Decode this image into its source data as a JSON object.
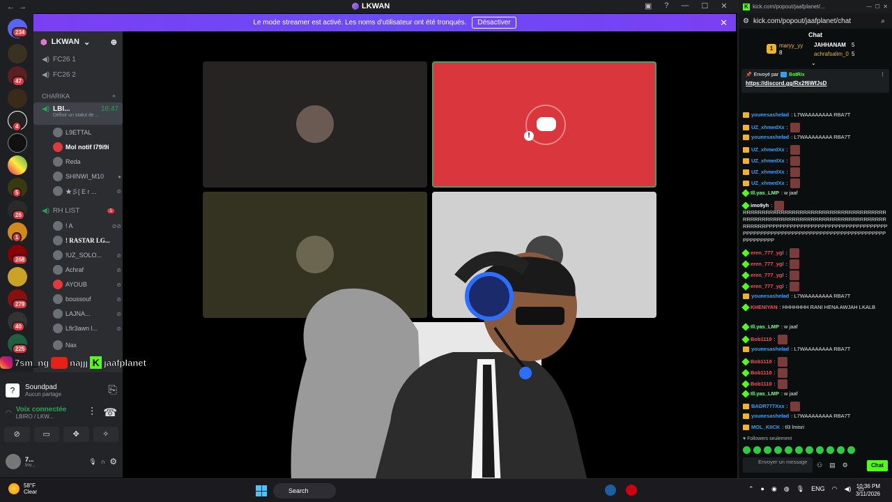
{
  "discord": {
    "window_title": "LKWAN",
    "banner_text": "Le mode streamer est activé. Les noms d'utilisateur ont été tronqués.",
    "banner_button": "Désactiver",
    "server_name": "LKWAN",
    "guild_badges": [
      "234",
      "47",
      "4",
      "5",
      "26",
      "1",
      "268",
      "279",
      "40",
      "225"
    ],
    "channels": [
      {
        "label": "FC26 1"
      },
      {
        "label": "FC26 2"
      }
    ],
    "category": "CHARIKA",
    "active_channel": {
      "label": "LBI...",
      "time": "16:47",
      "status": "Définir un statut de ..."
    },
    "active_users": [
      "L9ETTAL",
      "Mol notif l79i9i",
      "Reda",
      "SHINWI_M10",
      "★彡[ E r ..."
    ],
    "rh_channel": {
      "label": "RH LIST",
      "badge": "1"
    },
    "rh_users": [
      "! A",
      "! RASTAR LG...",
      "!UZ_SOLO...",
      "Achraf",
      "AYOUB",
      "boussouf",
      "LAJNA...",
      "Lfir3awn l...",
      "Nax"
    ],
    "soundpad": {
      "title": "Soundpad",
      "subtitle": "Aucun partage"
    },
    "voice": {
      "title": "Voix connectée",
      "subtitle": "LBIRO / LKW..."
    },
    "me": {
      "name": "7...",
      "status": "Inv..."
    }
  },
  "socials": [
    "7sm_ng",
    "najjj",
    "jaafplanet"
  ],
  "kick": {
    "title_url": "kick.com/popout/jaafplanet/...",
    "url": "kick.com/popout/jaafplanet/chat",
    "header": "Chat",
    "leaderboard": [
      {
        "rank": "1",
        "name": "maryy_yy",
        "count": "8"
      },
      {
        "name": "JAHHANAM",
        "count": "5"
      },
      {
        "name": "achrafsalim_0",
        "count": "5"
      }
    ],
    "pinned_by": "Envoyé par",
    "pinned_user": "BotRix",
    "pinned_link": "https://discord.gg/Rx2f6WfJsD",
    "messages": [
      {
        "user": "younesashelad",
        "text": ": L7WAAAAAAAA RBA7T",
        "color": "#2ea0ff"
      },
      {
        "user": "UZ_xhmedXx",
        "text": ":",
        "color": "#2ea0ff"
      },
      {
        "user": "younesashelad",
        "text": ": L7WAAAAAAAA RBA7T",
        "color": "#2ea0ff"
      },
      {
        "user": "UZ_xhmedXx",
        "text": ":",
        "color": "#2ea0ff"
      },
      {
        "user": "UZ_xhmedXx",
        "text": ":",
        "color": "#2ea0ff"
      },
      {
        "user": "UZ_xhmedXx",
        "text": ":",
        "color": "#2ea0ff"
      },
      {
        "user": "UZ_xhmedXx",
        "text": ":",
        "color": "#2ea0ff"
      },
      {
        "user": "Ill.yas_LMP",
        "text": ": w jaaf",
        "color": "#7cfc8a"
      },
      {
        "user": "imo9yh",
        "text": ":",
        "color": "#ffffff"
      },
      {
        "user": "",
        "text": "RRRRRRRRRRRRRRRRRRRRRRRRRRRRRRRRRRRRRRRRRRRRRRRRRRRRRRRRRRRRRRRRRRRRRRRRRRRRRRRRRRPPPPPPPPPPPPPPPPPPPPPPPPPPPPPPPPPPPPPPPPPPPPPPPPPPPPPPPPPPPPPPPPPPPPPPPPPPPPPPPPPPPPP",
        "color": "#ffffff"
      },
      {
        "user": "eren_777_ygl",
        "text": ":",
        "color": "#ff4d4d"
      },
      {
        "user": "eren_777_ygl",
        "text": ":",
        "color": "#ff4d4d"
      },
      {
        "user": "eren_777_ygl",
        "text": ":",
        "color": "#ff4d4d"
      },
      {
        "user": "eren_777_ygl",
        "text": ":",
        "color": "#ff4d4d"
      },
      {
        "user": "younesashelad",
        "text": ": L7WAAAAAAAA RBA7T",
        "color": "#2ea0ff"
      },
      {
        "user": "KHENIYAN",
        "text": ": HHHHHHH RANI HENA AWJAH LKALB",
        "color": "#ff4d4d"
      },
      {
        "user": "Ill.yas_LMP",
        "text": ": w jaaf",
        "color": "#7cfc8a"
      },
      {
        "user": "Bob1110",
        "text": ":",
        "color": "#ff4d4d"
      },
      {
        "user": "younesashelad",
        "text": ": L7WAAAAAAAA RBA7T",
        "color": "#2ea0ff"
      },
      {
        "user": "Bob1110",
        "text": ":",
        "color": "#ff4d4d"
      },
      {
        "user": "Bob1110",
        "text": ":",
        "color": "#ff4d4d"
      },
      {
        "user": "Bob1110",
        "text": ":",
        "color": "#ff4d4d"
      },
      {
        "user": "Ill.yas_LMP",
        "text": ": w jaaf",
        "color": "#7cfc8a"
      },
      {
        "user": "BADR777Xxx",
        "text": ":",
        "color": "#2ea0ff"
      },
      {
        "user": "younesashelad",
        "text": ": L7WAAAAAAAA RBA7T",
        "color": "#2ea0ff"
      },
      {
        "user": "MOL_KIICK",
        "text": ": tl3 lmisri",
        "color": "#2ea0ff"
      }
    ],
    "followers_only": "Followers seulement",
    "input_placeholder": "Envoyer un message",
    "chat_button": "Chat"
  },
  "taskbar": {
    "weather_temp": "58°F",
    "weather_desc": "Clear",
    "search": "Search",
    "lang": "ENG",
    "time": "10:36 PM",
    "date": "3/11/2026"
  }
}
